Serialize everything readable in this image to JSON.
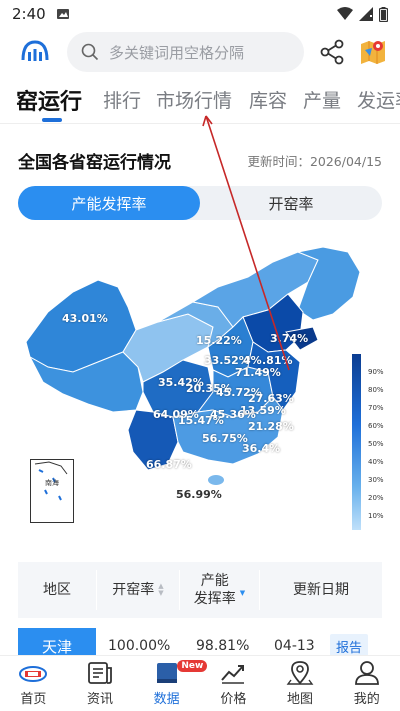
{
  "status_bar": {
    "time": "2:40"
  },
  "search": {
    "placeholder": "多关键词用空格分隔"
  },
  "tabs": [
    {
      "label": "窑运行",
      "active": true
    },
    {
      "label": "排行"
    },
    {
      "label": "市场行情"
    },
    {
      "label": "库容"
    },
    {
      "label": "产量"
    },
    {
      "label": "发运率"
    }
  ],
  "section": {
    "title": "全国各省窑运行情况",
    "update_time": "更新时间：2026/04/15"
  },
  "toggle": {
    "left": "产能发挥率",
    "right": "开窑率",
    "selected": "产能发挥率"
  },
  "map": {
    "labels": [
      "43.01%",
      "15.22%",
      "33.52%",
      "4%",
      ".81%",
      "3.74%",
      "71.49%",
      "35.42%",
      "20.35%",
      "45.72%",
      "27.63%",
      "13.59%",
      "64.09%",
      "15.47%",
      "45.36%",
      "21.28%",
      "56.75%",
      "36.4%",
      "66.87%",
      "56.99%"
    ],
    "legend_ticks": [
      "90%",
      "80%",
      "70%",
      "60%",
      "50%",
      "40%",
      "30%",
      "20%",
      "10%"
    ],
    "inset_label": "南海"
  },
  "table": {
    "headers": {
      "region": "地区",
      "open_rate": "开窑率",
      "capacity_line1": "产能",
      "capacity_line2": "发挥率",
      "update_date": "更新日期"
    },
    "rows": [
      {
        "region": "天津",
        "open_rate": "100.00%",
        "capacity": "98.81%",
        "date": "04-13",
        "action": "报告"
      }
    ]
  },
  "bottom_nav": [
    {
      "label": "首页"
    },
    {
      "label": "资讯"
    },
    {
      "label": "数据",
      "active": true,
      "badge": "New"
    },
    {
      "label": "价格"
    },
    {
      "label": "地图"
    },
    {
      "label": "我的"
    }
  ],
  "colors": {
    "accent": "#2b8ef0",
    "map_dark": "#0b3d91",
    "map_light": "#bfe0fa",
    "annotation": "#c62828"
  }
}
